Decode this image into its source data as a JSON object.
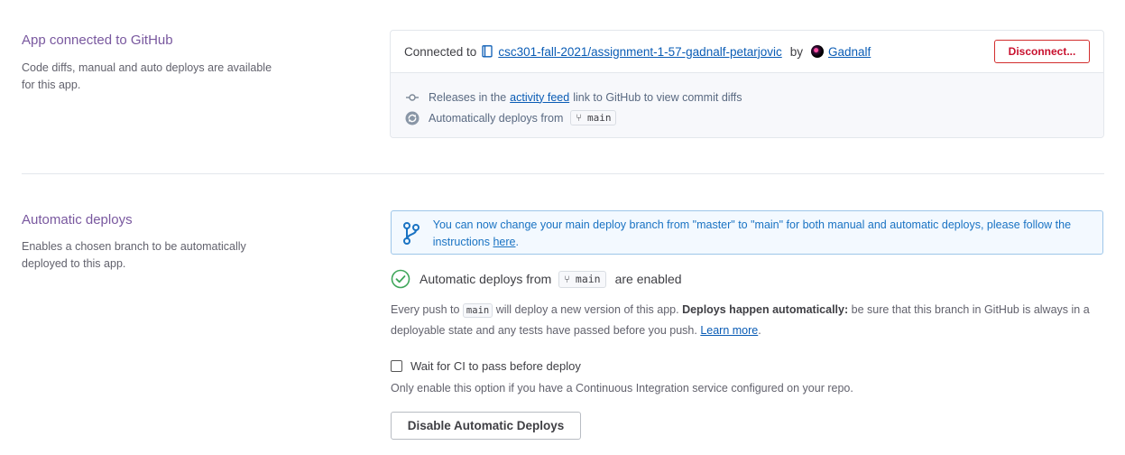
{
  "github_section": {
    "title": "App connected to GitHub",
    "description": "Code diffs, manual and auto deploys are available for this app.",
    "connected_to_label": "Connected to",
    "repo_name": "csc301-fall-2021/assignment-1-57-gadnalf-petarjovic",
    "by_label": "by",
    "owner_name": "Gadnalf",
    "disconnect_label": "Disconnect...",
    "releases_text_before": "Releases in the",
    "activity_feed_link": "activity feed",
    "releases_text_after": "link to GitHub to view commit diffs",
    "auto_deploys_from_label": "Automatically deploys from",
    "branch": "main"
  },
  "auto_section": {
    "title": "Automatic deploys",
    "description": "Enables a chosen branch to be automatically deployed to this app.",
    "banner_text": "You can now change your main deploy branch from \"master\" to \"main\" for both manual and automatic deploys, please follow the instructions",
    "banner_link": "here",
    "banner_period": ".",
    "enabled_prefix": "Automatic deploys from",
    "enabled_branch": "main",
    "enabled_suffix": "are enabled",
    "push_prefix": "Every push to",
    "push_branch": "main",
    "push_middle": "will deploy a new version of this app.",
    "push_bold": "Deploys happen automatically:",
    "push_rest": "be sure that this branch in GitHub is always in a deployable state and any tests have passed before you push.",
    "learn_more": "Learn more",
    "learn_more_period": ".",
    "ci_label": "Wait for CI to pass before deploy",
    "ci_checked": false,
    "ci_note": "Only enable this option if you have a Continuous Integration service configured on your repo.",
    "disable_button": "Disable Automatic Deploys"
  },
  "colors": {
    "heading_purple": "#79589f",
    "link_blue": "#0a5cb5",
    "danger_red": "#c8102e",
    "banner_blue": "#1a73c3",
    "success_green": "#3fa65a"
  },
  "icons": {
    "repo": "repo-icon",
    "avatar": "avatar",
    "commit": "commit-icon",
    "sync": "sync-icon",
    "branch": "branch-icon",
    "check": "check-circle-icon"
  }
}
